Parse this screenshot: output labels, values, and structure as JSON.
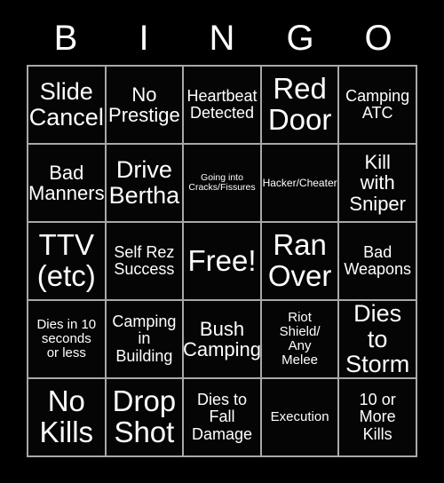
{
  "card": {
    "title": "BINGO",
    "background_color": "#000000",
    "text_color": "#ffffff",
    "grid_line_color": "#a8a8a8"
  },
  "header": {
    "letters": [
      "B",
      "I",
      "N",
      "G",
      "O"
    ]
  },
  "grid": {
    "columns": 5,
    "rows": 5,
    "cells": [
      {
        "text": "Slide\nCancel",
        "size": "xl"
      },
      {
        "text": "No\nPrestige",
        "size": "lg"
      },
      {
        "text": "Heartbeat\nDetected",
        "size": "md"
      },
      {
        "text": "Red\nDoor",
        "size": "xxl"
      },
      {
        "text": "Camping\nATC",
        "size": "md"
      },
      {
        "text": "Bad\nManners",
        "size": "lg"
      },
      {
        "text": "Drive\nBertha",
        "size": "xl"
      },
      {
        "text": "Going into\nCracks/Fissures",
        "size": "xxs"
      },
      {
        "text": "Hacker/Cheater",
        "size": "xs"
      },
      {
        "text": "Kill\nwith\nSniper",
        "size": "lg"
      },
      {
        "text": "TTV\n(etc)",
        "size": "xxl"
      },
      {
        "text": "Self Rez\nSuccess",
        "size": "md"
      },
      {
        "text": "Free!",
        "size": "xxl"
      },
      {
        "text": "Ran\nOver",
        "size": "xxl"
      },
      {
        "text": "Bad\nWeapons",
        "size": "md"
      },
      {
        "text": "Dies in 10\nseconds\nor less",
        "size": "sm"
      },
      {
        "text": "Camping\nin\nBuilding",
        "size": "md"
      },
      {
        "text": "Bush\nCamping",
        "size": "lg"
      },
      {
        "text": "Riot\nShield/\nAny\nMelee",
        "size": "sm"
      },
      {
        "text": "Dies to\nStorm",
        "size": "xl"
      },
      {
        "text": "No\nKills",
        "size": "xxl"
      },
      {
        "text": "Drop\nShot",
        "size": "xxl"
      },
      {
        "text": "Dies to\nFall\nDamage",
        "size": "md"
      },
      {
        "text": "Execution",
        "size": "sm"
      },
      {
        "text": "10 or\nMore\nKills",
        "size": "md"
      }
    ]
  }
}
